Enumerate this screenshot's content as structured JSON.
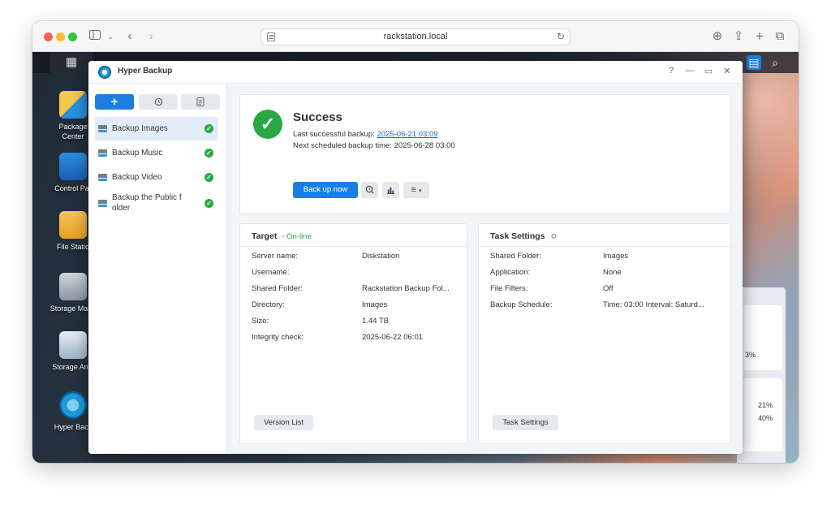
{
  "browser": {
    "url": "rackstation.local"
  },
  "desktop": {
    "icons": [
      {
        "label": "Package\nCenter"
      },
      {
        "label": "Control Par"
      },
      {
        "label": "File Statio"
      },
      {
        "label": "Storage Mana"
      },
      {
        "label": "Storage Anal"
      },
      {
        "label": "Hyper Back"
      }
    ],
    "widget_values": {
      "a": "3%",
      "b": "21%",
      "c": "40%"
    }
  },
  "app": {
    "title": "Hyper Backup",
    "window_controls": {
      "help": "?",
      "minimize": "—",
      "maximize": "▭",
      "close": "✕"
    },
    "toolbar": {
      "add": "+",
      "history": "↺",
      "log": "▤"
    },
    "tasks": [
      {
        "label": "Backup Images",
        "selected": true,
        "status": "ok"
      },
      {
        "label": "Backup Music",
        "selected": false,
        "status": "ok"
      },
      {
        "label": "Backup Video",
        "selected": false,
        "status": "ok"
      },
      {
        "label": "Backup the Public f older",
        "selected": false,
        "status": "ok"
      }
    ],
    "status": {
      "title": "Success",
      "last_label": "Last successful backup:",
      "last_value": "2025-06-21 03:09",
      "next_label": "Next scheduled backup time:",
      "next_value": "2025-06-28 03:00",
      "backup_now": "Back up now"
    },
    "target": {
      "title": "Target",
      "state": "- On-line",
      "rows": [
        {
          "k": "Server name:",
          "v": "Diskstation"
        },
        {
          "k": "Username:",
          "v": ""
        },
        {
          "k": "Shared Folder:",
          "v": "Rackstation Backup Fol..."
        },
        {
          "k": "Directory:",
          "v": "Images"
        },
        {
          "k": "Size:",
          "v": "1.44 TB"
        },
        {
          "k": "Integrity check:",
          "v": "2025-06-22 06:01"
        }
      ],
      "button": "Version List"
    },
    "settings": {
      "title": "Task Settings",
      "rows": [
        {
          "k": "Shared Folder:",
          "v": "Images"
        },
        {
          "k": "Application:",
          "v": "None"
        },
        {
          "k": "File Filters:",
          "v": "Off"
        },
        {
          "k": "Backup Schedule:",
          "v": "Time: 03:00 Interval: Saturd..."
        }
      ],
      "button": "Task Settings"
    }
  },
  "colors": {
    "accent": "#1a7fe0",
    "success": "#28a845"
  }
}
